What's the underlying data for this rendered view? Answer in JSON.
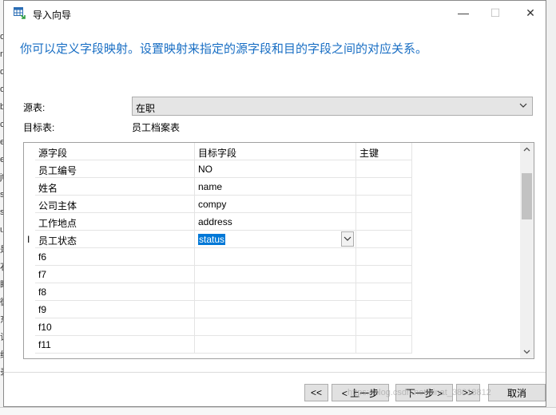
{
  "window": {
    "title": "导入向导",
    "minimize": "—",
    "maximize": "☐",
    "close": "✕"
  },
  "instruction": "你可以定义字段映射。设置映射来指定的源字段和目的字段之间的对应关系。",
  "source": {
    "label": "源表:",
    "value": "在职"
  },
  "target": {
    "label": "目标表:",
    "value": "员工档案表"
  },
  "grid": {
    "headers": [
      "源字段",
      "目标字段",
      "主键"
    ],
    "rows": [
      {
        "source": "员工编号",
        "target": "NO",
        "pk": ""
      },
      {
        "source": "姓名",
        "target": "name",
        "pk": ""
      },
      {
        "source": "公司主体",
        "target": "compy",
        "pk": ""
      },
      {
        "source": "工作地点",
        "target": "address",
        "pk": ""
      },
      {
        "source": "员工状态",
        "target": "status",
        "pk": ""
      },
      {
        "source": "f6",
        "target": "",
        "pk": ""
      },
      {
        "source": "f7",
        "target": "",
        "pk": ""
      },
      {
        "source": "f8",
        "target": "",
        "pk": ""
      },
      {
        "source": "f9",
        "target": "",
        "pk": ""
      },
      {
        "source": "f10",
        "target": "",
        "pk": ""
      },
      {
        "source": "f11",
        "target": "",
        "pk": ""
      }
    ],
    "row_cursor": "I"
  },
  "buttons": {
    "first": "<<",
    "prev": "< 上一步",
    "next": "下一步 >",
    "last": ">>",
    "cancel": "取消"
  },
  "watermark": "https://blog.csdn.net/sinat_38018812",
  "background_snippets": [
    "os",
    "rr",
    "q",
    "o",
    "b",
    "c",
    "e",
    "e",
    "jt",
    "s",
    "s",
    "u",
    "是",
    "石",
    "眼",
    "微",
    "东",
    "试",
    "线",
    "录"
  ],
  "colors": {
    "instruction": "#1a6fc4",
    "selection": "#0078d7"
  }
}
